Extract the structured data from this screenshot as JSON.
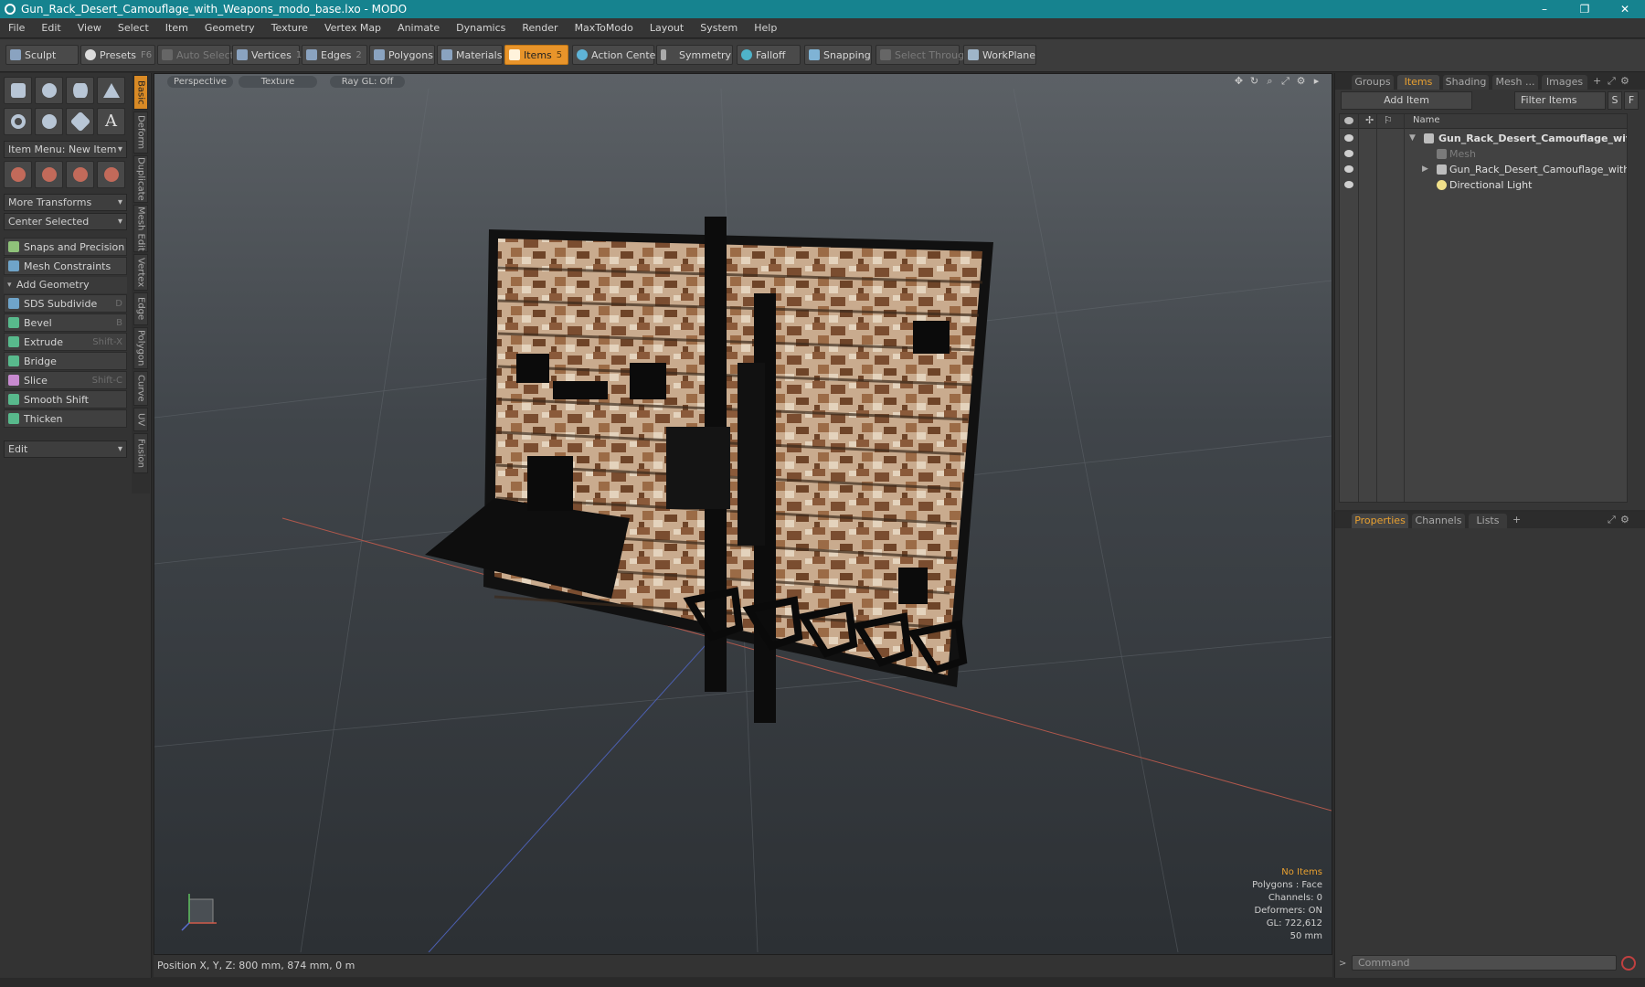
{
  "window": {
    "title": "Gun_Rack_Desert_Camouflage_with_Weapons_modo_base.lxo - MODO",
    "minimize": "–",
    "maximize": "❐",
    "close": "✕"
  },
  "menu": [
    "File",
    "Edit",
    "View",
    "Select",
    "Item",
    "Geometry",
    "Texture",
    "Vertex Map",
    "Animate",
    "Dynamics",
    "Render",
    "MaxToModo",
    "Layout",
    "System",
    "Help"
  ],
  "toolbar": {
    "sculpt": "Sculpt",
    "presets": "Presets",
    "presets_key": "F6",
    "auto_select": "Auto Select",
    "vertices": "Vertices",
    "vertices_key": "1",
    "edges": "Edges",
    "edges_key": "2",
    "polygons": "Polygons",
    "materials": "Materials",
    "items": "Items",
    "items_key": "5",
    "action_center": "Action Center",
    "symmetry": "Symmetry",
    "falloff": "Falloff",
    "snapping": "Snapping",
    "select_through": "Select Through",
    "workplane": "WorkPlane"
  },
  "left": {
    "item_menu": "Item Menu: New Item",
    "more_transforms": "More Transforms",
    "center_selected": "Center Selected",
    "snaps": "Snaps and Precision",
    "mesh_constraints": "Mesh Constraints",
    "add_geometry": "Add Geometry",
    "tools": [
      {
        "label": "SDS Subdivide",
        "key": "D"
      },
      {
        "label": "Bevel",
        "key": "B"
      },
      {
        "label": "Extrude",
        "key": "Shift-X"
      },
      {
        "label": "Bridge",
        "key": ""
      },
      {
        "label": "Slice",
        "key": "Shift-C"
      },
      {
        "label": "Smooth Shift",
        "key": ""
      },
      {
        "label": "Thicken",
        "key": ""
      }
    ],
    "edit": "Edit",
    "vtabs": [
      "Basic",
      "Deform",
      "Duplicate",
      "Mesh Edit",
      "Vertex",
      "Edge",
      "Polygon",
      "Curve",
      "UV",
      "Fusion"
    ]
  },
  "viewport": {
    "view": "Perspective",
    "shading": "Texture",
    "raygl": "Ray GL: Off",
    "info": {
      "items": "No Items",
      "polygons": "Polygons : Face",
      "channels": "Channels: 0",
      "deformers": "Deformers: ON",
      "gl": "GL: 722,612",
      "scale": "50 mm"
    }
  },
  "status": {
    "position": "Position X, Y, Z:  800 mm, 874 mm, 0 m"
  },
  "items_panel": {
    "tabs": [
      "Groups",
      "Items",
      "Shading",
      "Mesh ...",
      "Images"
    ],
    "add_item": "Add Item",
    "filter": "Filter Items",
    "filter_s": "S",
    "filter_f": "F",
    "col_name": "Name",
    "rows": [
      {
        "label": "Gun_Rack_Desert_Camouflage_with..."
      },
      {
        "label": "Mesh"
      },
      {
        "label": "Gun_Rack_Desert_Camouflage_with_W ..."
      },
      {
        "label": "Directional Light"
      }
    ]
  },
  "props_panel": {
    "tabs": [
      "Properties",
      "Channels",
      "Lists"
    ],
    "add": "+",
    "command": "Command"
  },
  "colors": {
    "accent": "#e8942a",
    "titlebar": "#16838f"
  }
}
